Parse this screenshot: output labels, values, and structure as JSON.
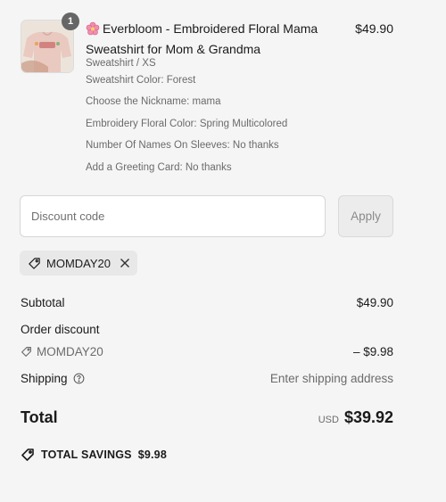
{
  "item": {
    "quantity": "1",
    "title": "Everbloom - Embroidered Floral Mama Sweatshirt for Mom & Grandma",
    "price": "$49.90",
    "variant": "Sweatshirt / XS",
    "options": [
      "Sweatshirt Color: Forest",
      "Choose the Nickname: mama",
      "Embroidery Floral Color: Spring Multicolored",
      "Number Of Names On Sleeves: No thanks",
      "Add a Greeting Card: No thanks"
    ]
  },
  "discount": {
    "placeholder": "Discount code",
    "apply_label": "Apply",
    "applied_code": "MOMDAY20"
  },
  "summary": {
    "subtotal_label": "Subtotal",
    "subtotal_value": "$49.90",
    "order_discount_label": "Order discount",
    "discount_code": "MOMDAY20",
    "discount_value": "– $9.98",
    "shipping_label": "Shipping",
    "shipping_value": "Enter shipping address",
    "total_label": "Total",
    "currency": "USD",
    "total_value": "$39.92",
    "savings_label": "TOTAL SAVINGS",
    "savings_value": "$9.98"
  },
  "icons": {
    "flower": "flower-icon",
    "tag": "tag-icon",
    "close": "close-icon",
    "help": "help-circle-icon"
  }
}
